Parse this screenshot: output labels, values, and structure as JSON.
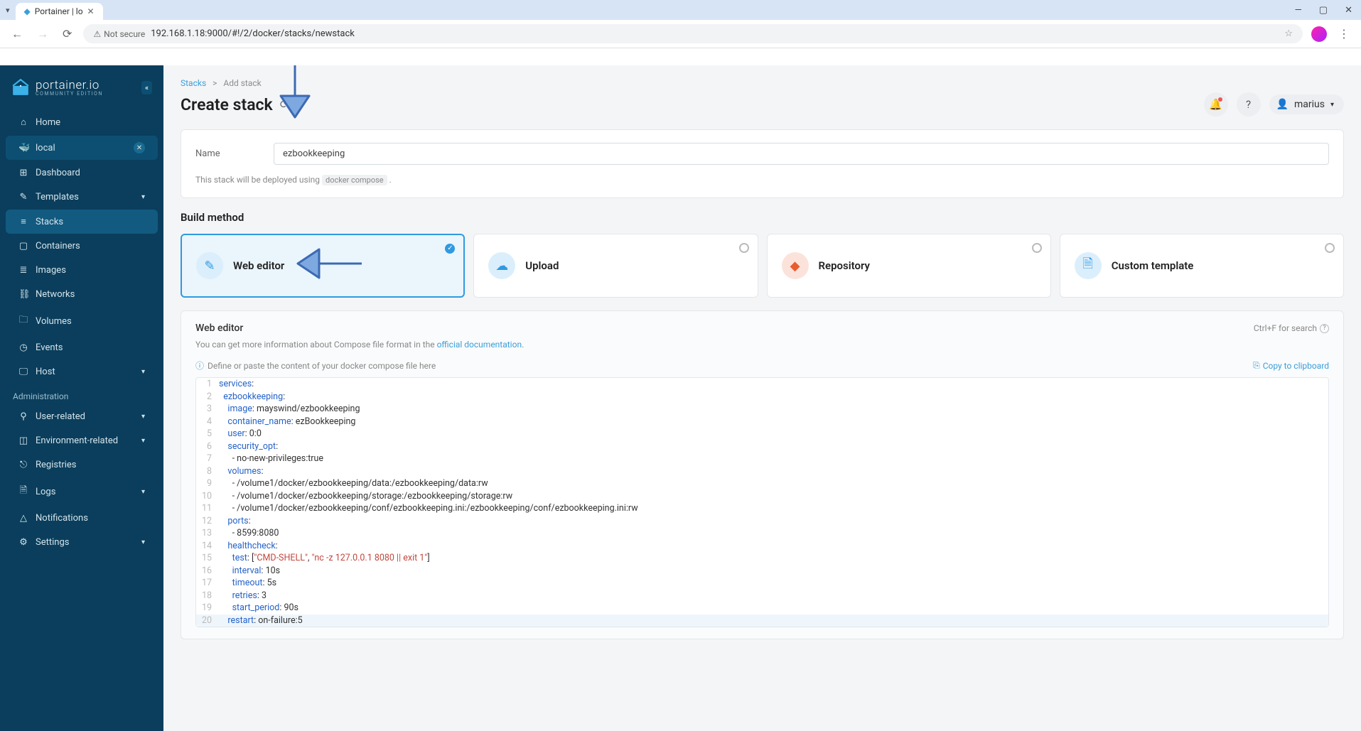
{
  "browser": {
    "tab_title": "Portainer | lo",
    "url": "192.168.1.18:9000/#!/2/docker/stacks/newstack",
    "security": "Not secure"
  },
  "sidebar": {
    "brand": "portainer.io",
    "edition": "COMMUNITY EDITION",
    "home": "Home",
    "local": "local",
    "items": [
      {
        "icon": "⊞",
        "label": "Dashboard"
      },
      {
        "icon": "✎",
        "label": "Templates",
        "chev": true
      },
      {
        "icon": "≡",
        "label": "Stacks",
        "active": true
      },
      {
        "icon": "▢",
        "label": "Containers"
      },
      {
        "icon": "≣",
        "label": "Images"
      },
      {
        "icon": "⛓",
        "label": "Networks"
      },
      {
        "icon": "🗀",
        "label": "Volumes"
      },
      {
        "icon": "◷",
        "label": "Events"
      },
      {
        "icon": "🖵",
        "label": "Host",
        "chev": true
      }
    ],
    "admin_header": "Administration",
    "admin": [
      {
        "icon": "⚲",
        "label": "User-related",
        "chev": true
      },
      {
        "icon": "◫",
        "label": "Environment-related",
        "chev": true
      },
      {
        "icon": "⎋",
        "label": "Registries"
      },
      {
        "icon": "🗎",
        "label": "Logs",
        "chev": true
      },
      {
        "icon": "△",
        "label": "Notifications"
      },
      {
        "icon": "⚙",
        "label": "Settings",
        "chev": true
      }
    ]
  },
  "breadcrumb": {
    "root": "Stacks",
    "sep": ">",
    "leaf": "Add stack"
  },
  "page_title": "Create stack",
  "user": {
    "name": "marius"
  },
  "form": {
    "name_label": "Name",
    "name_value": "ezbookkeeping",
    "deploy_note_pre": "This stack will be deployed using ",
    "deploy_note_code": "docker compose",
    "deploy_note_post": " ."
  },
  "build": {
    "heading": "Build method",
    "methods": [
      {
        "label": "Web editor",
        "selected": true
      },
      {
        "label": "Upload"
      },
      {
        "label": "Repository"
      },
      {
        "label": "Custom template"
      }
    ]
  },
  "editor": {
    "title": "Web editor",
    "search_hint": "Ctrl+F for search",
    "desc_pre": "You can get more information about Compose file format in the ",
    "desc_link": "official documentation",
    "desc_post": ".",
    "define_hint": "Define or paste the content of your docker compose file here",
    "copy": "Copy to clipboard",
    "code": [
      [
        [
          "k",
          "services"
        ],
        [
          "p",
          ":"
        ]
      ],
      [
        [
          "t",
          "  "
        ],
        [
          "k",
          "ezbookkeeping"
        ],
        [
          "p",
          ":"
        ]
      ],
      [
        [
          "t",
          "    "
        ],
        [
          "k",
          "image"
        ],
        [
          "p",
          ": "
        ],
        [
          "v",
          "mayswind/ezbookkeeping"
        ]
      ],
      [
        [
          "t",
          "    "
        ],
        [
          "k",
          "container_name"
        ],
        [
          "p",
          ": "
        ],
        [
          "v",
          "ezBookkeeping"
        ]
      ],
      [
        [
          "t",
          "    "
        ],
        [
          "k",
          "user"
        ],
        [
          "p",
          ": "
        ],
        [
          "v",
          "0:0"
        ]
      ],
      [
        [
          "t",
          "    "
        ],
        [
          "k",
          "security_opt"
        ],
        [
          "p",
          ":"
        ]
      ],
      [
        [
          "t",
          "      - "
        ],
        [
          "v",
          "no-new-privileges:true"
        ]
      ],
      [
        [
          "t",
          "    "
        ],
        [
          "k",
          "volumes"
        ],
        [
          "p",
          ":"
        ]
      ],
      [
        [
          "t",
          "      - "
        ],
        [
          "v",
          "/volume1/docker/ezbookkeeping/data:/ezbookkeeping/data:rw"
        ]
      ],
      [
        [
          "t",
          "      - "
        ],
        [
          "v",
          "/volume1/docker/ezbookkeeping/storage:/ezbookkeeping/storage:rw"
        ]
      ],
      [
        [
          "t",
          "      - "
        ],
        [
          "v",
          "/volume1/docker/ezbookkeeping/conf/ezbookkeeping.ini:/ezbookkeeping/conf/ezbookkeeping.ini:rw"
        ]
      ],
      [
        [
          "t",
          "    "
        ],
        [
          "k",
          "ports"
        ],
        [
          "p",
          ":"
        ]
      ],
      [
        [
          "t",
          "      - "
        ],
        [
          "v",
          "8599:8080"
        ]
      ],
      [
        [
          "t",
          "    "
        ],
        [
          "k",
          "healthcheck"
        ],
        [
          "p",
          ":"
        ]
      ],
      [
        [
          "t",
          "      "
        ],
        [
          "k",
          "test"
        ],
        [
          "p",
          ": ["
        ],
        [
          "s",
          "\"CMD-SHELL\""
        ],
        [
          "p",
          ", "
        ],
        [
          "s",
          "\"nc -z 127.0.0.1 8080 || exit 1\""
        ],
        [
          "p",
          "]"
        ]
      ],
      [
        [
          "t",
          "      "
        ],
        [
          "k",
          "interval"
        ],
        [
          "p",
          ": "
        ],
        [
          "v",
          "10s"
        ]
      ],
      [
        [
          "t",
          "      "
        ],
        [
          "k",
          "timeout"
        ],
        [
          "p",
          ": "
        ],
        [
          "v",
          "5s"
        ]
      ],
      [
        [
          "t",
          "      "
        ],
        [
          "k",
          "retries"
        ],
        [
          "p",
          ": "
        ],
        [
          "v",
          "3"
        ]
      ],
      [
        [
          "t",
          "      "
        ],
        [
          "k",
          "start_period"
        ],
        [
          "p",
          ": "
        ],
        [
          "v",
          "90s"
        ]
      ],
      [
        [
          "t",
          "    "
        ],
        [
          "k",
          "restart"
        ],
        [
          "p",
          ": "
        ],
        [
          "v",
          "on-failure:5"
        ]
      ]
    ]
  }
}
